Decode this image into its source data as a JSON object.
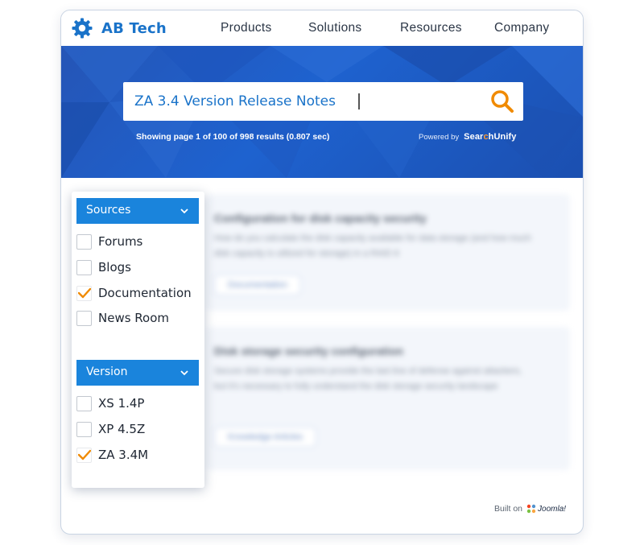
{
  "header": {
    "brand": "AB Tech",
    "nav": [
      "Products",
      "Solutions",
      "Resources",
      "Company"
    ]
  },
  "search": {
    "query": "ZA 3.4 Version Release Notes",
    "results_text": "Showing page 1 of 100 of 998 results (0.807 sec)",
    "powered_by": "Powered by",
    "provider_prefix": "Sear",
    "provider_highlight": "c",
    "provider_suffix": "hUnify"
  },
  "results": [
    {
      "title": "Configuration for disk capacity security",
      "description": "How do you calculate the disk capacity available for data storage (and how much disk capacity is utilized for storage) in a RAID 6",
      "tag": "Documentation"
    },
    {
      "title": "Disk storage security configuration",
      "description": "Secure disk storage systems provide the last line of defense against attackers, but it's necessary to fully understand the disk storage security landscape",
      "tag": "Knowledge Articles"
    }
  ],
  "filters": {
    "sources": {
      "title": "Sources",
      "options": [
        {
          "label": "Forums",
          "checked": false
        },
        {
          "label": "Blogs",
          "checked": false
        },
        {
          "label": "Documentation",
          "checked": true
        },
        {
          "label": "News Room",
          "checked": false
        }
      ]
    },
    "version": {
      "title": "Version",
      "options": [
        {
          "label": "XS 1.4P",
          "checked": false
        },
        {
          "label": "XP 4.5Z",
          "checked": false
        },
        {
          "label": "ZA 3.4M",
          "checked": true
        }
      ]
    }
  },
  "footer": {
    "built_on": "Built on",
    "platform": "Joomla!"
  },
  "colors": {
    "brand_blue": "#1a73c9",
    "facet_header": "#1a84dc",
    "accent_orange": "#f08a00"
  }
}
